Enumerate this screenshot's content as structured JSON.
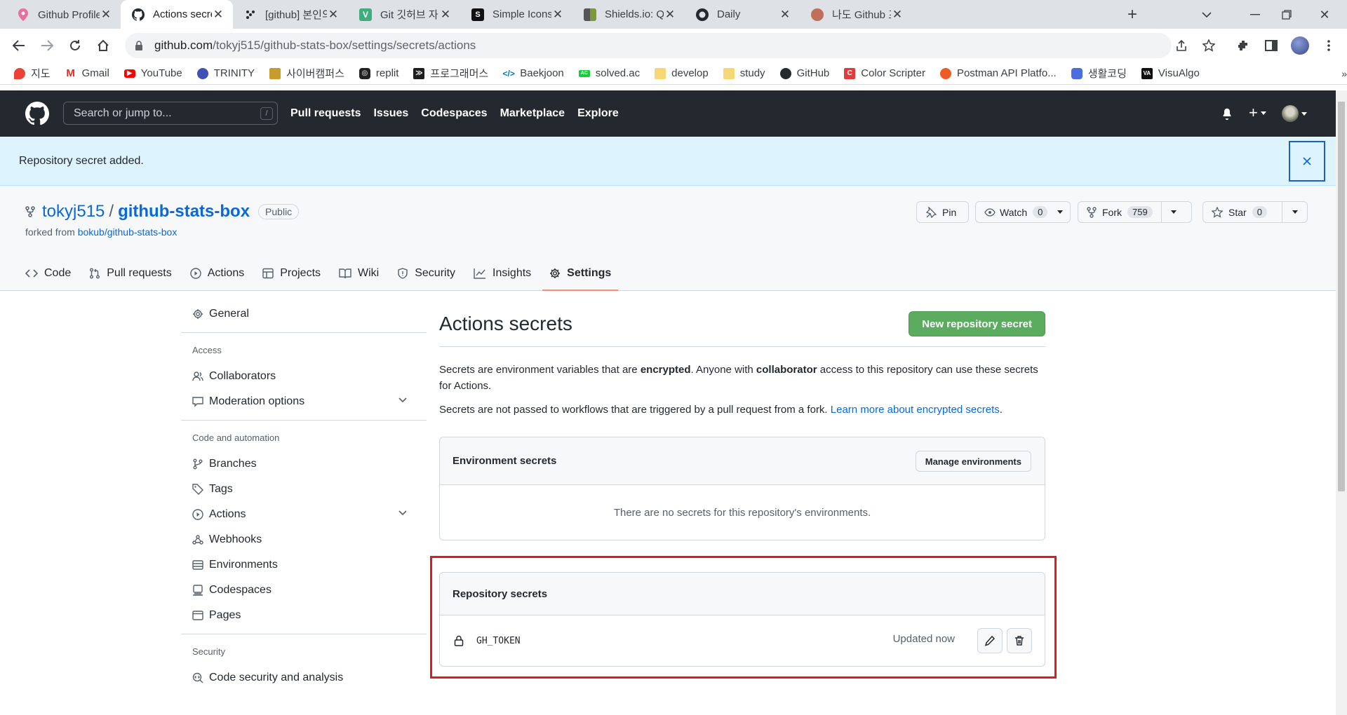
{
  "browser": {
    "tabs": [
      {
        "title": "Github Profile 꾸미기",
        "favicon": "pin-icon",
        "color": "#e8709c"
      },
      {
        "title": "Actions secrets",
        "favicon": "github-icon",
        "color": "#24292f"
      },
      {
        "title": "[github] 본인의 잔디",
        "favicon": "dots-icon",
        "color": "#24292f"
      },
      {
        "title": "Git 깃허브 자기소개",
        "favicon": "v-icon",
        "color": "#3eaf7c"
      },
      {
        "title": "Simple Icons",
        "favicon": "simpleicons-icon",
        "color": "#111111"
      },
      {
        "title": "Shields.io: Quality",
        "favicon": "shields-icon",
        "color": "#5c7c3a"
      },
      {
        "title": "Daily",
        "favicon": "github-icon",
        "color": "#24292f"
      },
      {
        "title": "나도 Github 프로필",
        "favicon": "avatar-icon",
        "color": "#c0705a"
      }
    ],
    "url_host": "github.com",
    "url_path": "/tokyj515/github-stats-box/settings/secrets/actions",
    "bookmarks": [
      {
        "label": "지도",
        "color": "#ea4335"
      },
      {
        "label": "Gmail",
        "color": "#d93025"
      },
      {
        "label": "YouTube",
        "color": "#ff0000"
      },
      {
        "label": "TRINITY",
        "color": "#3f51b5"
      },
      {
        "label": "사이버캠퍼스",
        "color": "#c69d2d"
      },
      {
        "label": "replit",
        "color": "#222222"
      },
      {
        "label": "프로그래머스",
        "color": "#1e1e1e"
      },
      {
        "label": "Baekjoon",
        "color": "#0076c0"
      },
      {
        "label": "solved.ac",
        "color": "#17ce3a"
      },
      {
        "label": "develop",
        "color": "#f7d774"
      },
      {
        "label": "study",
        "color": "#f7d774"
      },
      {
        "label": "GitHub",
        "color": "#24292f"
      },
      {
        "label": "Color Scripter",
        "color": "#e03c3c"
      },
      {
        "label": "Postman API Platfo...",
        "color": "#ef5b25"
      },
      {
        "label": "생활코딩",
        "color": "#4a6ee0"
      },
      {
        "label": "VisuAlgo",
        "color": "#111111"
      }
    ]
  },
  "gh": {
    "search_placeholder": "Search or jump to...",
    "search_key": "/",
    "nav": [
      "Pull requests",
      "Issues",
      "Codespaces",
      "Marketplace",
      "Explore"
    ]
  },
  "flash": {
    "message": "Repository secret added."
  },
  "repo": {
    "owner": "tokyj515",
    "name": "github-stats-box",
    "visibility": "Public",
    "forked_prefix": "forked from ",
    "forked_from": "bokub/github-stats-box",
    "pin_label": "Pin",
    "watch_label": "Watch",
    "watch_count": "0",
    "fork_label": "Fork",
    "fork_count": "759",
    "star_label": "Star",
    "star_count": "0",
    "tabs": [
      "Code",
      "Pull requests",
      "Actions",
      "Projects",
      "Wiki",
      "Security",
      "Insights",
      "Settings"
    ],
    "selected_tab": "Settings"
  },
  "sidebar": {
    "general": "General",
    "sections": [
      {
        "heading": "Access",
        "items": [
          "Collaborators",
          "Moderation options"
        ]
      },
      {
        "heading": "Code and automation",
        "items": [
          "Branches",
          "Tags",
          "Actions",
          "Webhooks",
          "Environments",
          "Codespaces",
          "Pages"
        ]
      },
      {
        "heading": "Security",
        "items": [
          "Code security and analysis"
        ]
      }
    ]
  },
  "main": {
    "title": "Actions secrets",
    "new_button": "New repository secret",
    "p1_a": "Secrets are environment variables that are ",
    "p1_b": "encrypted",
    "p1_c": ". Anyone with ",
    "p1_d": "collaborator",
    "p1_e": " access to this repository can use these secrets for Actions.",
    "p2_a": "Secrets are not passed to workflows that are triggered by a pull request from a fork. ",
    "p2_link": "Learn more about encrypted secrets",
    "p2_end": ".",
    "env_title": "Environment secrets",
    "manage_button": "Manage environments",
    "env_empty": "There are no secrets for this repository's environments.",
    "repo_title": "Repository secrets",
    "secret_name": "GH_TOKEN",
    "secret_updated": "Updated now"
  }
}
